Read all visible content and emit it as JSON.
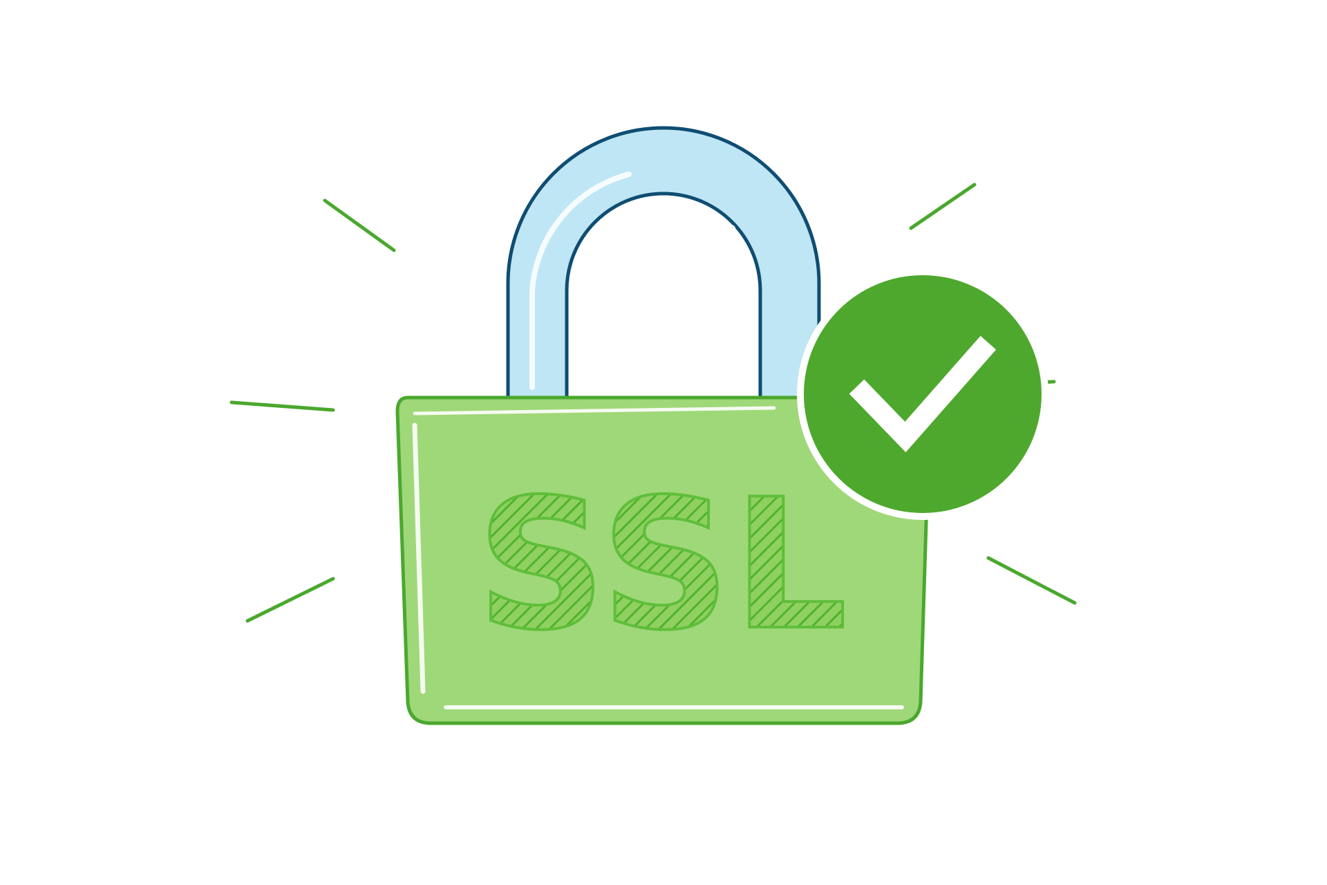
{
  "illustration": {
    "lock_label": "SSL",
    "icons": {
      "lock": "padlock-icon",
      "check": "checkmark-icon",
      "rays": "sparkle-lines"
    },
    "colors": {
      "background": "#ffffff",
      "shackle_fill": "#bfe6f4",
      "shackle_outline": "#0f4d72",
      "lock_body": "#9fd878",
      "lock_body_outline": "#4aa82e",
      "label_hatch": "#5fbe3a",
      "badge_fill": "#4ea82e",
      "badge_ring": "#ffffff",
      "check": "#ffffff",
      "rays": "#4aa82e"
    }
  }
}
